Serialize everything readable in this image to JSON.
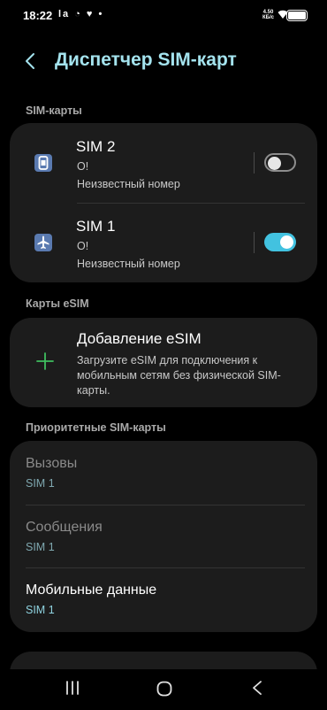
{
  "status_bar": {
    "time": "18:22",
    "left_icons": "la ◔ ♥ •",
    "net_speed_top": "4.50",
    "net_speed_bottom": "КБ/с"
  },
  "header": {
    "title": "Диспетчер SIM-карт"
  },
  "sections": {
    "sim_cards": "SIM-карты",
    "esim": "Карты eSIM",
    "priority": "Приоритетные SIM-карты"
  },
  "sims": [
    {
      "name": "SIM 2",
      "operator": "O!",
      "number": "Неизвестный номер",
      "enabled": false,
      "icon": "sim-card-icon"
    },
    {
      "name": "SIM 1",
      "operator": "O!",
      "number": "Неизвестный номер",
      "enabled": true,
      "icon": "airplane-icon"
    }
  ],
  "esim": {
    "title": "Добавление eSIM",
    "description": "Загрузите eSIM для подключения к мобильным сетям без физической SIM-карты.",
    "icon": "plus-icon"
  },
  "priority": [
    {
      "title": "Вызовы",
      "value": "SIM 1",
      "enabled": false
    },
    {
      "title": "Сообщения",
      "value": "SIM 1",
      "enabled": false
    },
    {
      "title": "Мобильные данные",
      "value": "SIM 1",
      "enabled": true
    }
  ],
  "colors": {
    "accent": "#42c2e0",
    "title": "#a4e3ee",
    "card": "#1c1c1c",
    "plus": "#3fbf5f"
  }
}
